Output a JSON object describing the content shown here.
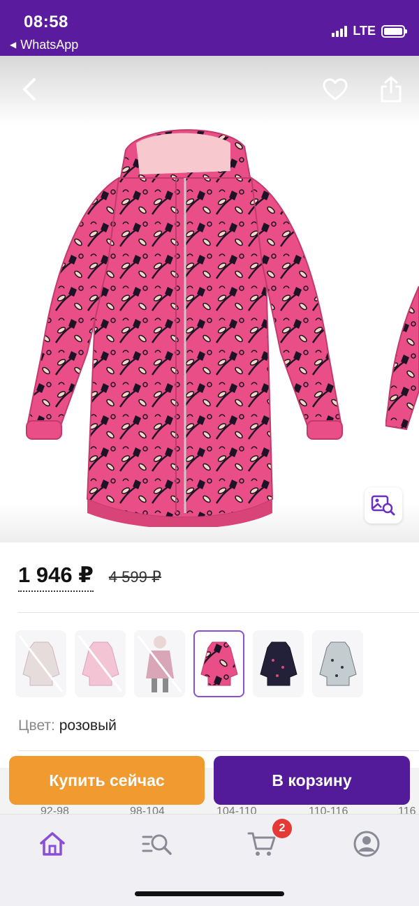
{
  "status_bar": {
    "time": "08:58",
    "back_app": "WhatsApp",
    "network": "LTE",
    "background_color": "#5a1b9e"
  },
  "header": {
    "back_icon": "chevron-left-icon",
    "favorite_icon": "heart-outline-icon",
    "share_icon": "share-icon"
  },
  "product": {
    "price": "1 946 ₽",
    "old_price": "4 599 ₽",
    "color_label": "Цвет:",
    "color_value": "розовый",
    "main_image": "pink floral winter jacket",
    "zoom_icon": "image-search-icon"
  },
  "color_variants": [
    {
      "name": "light-floral",
      "available": false,
      "selected": false
    },
    {
      "name": "pink-pale",
      "available": false,
      "selected": false
    },
    {
      "name": "pink-model",
      "available": false,
      "selected": false
    },
    {
      "name": "pink-floral",
      "available": true,
      "selected": true
    },
    {
      "name": "navy-floral",
      "available": true,
      "selected": false
    },
    {
      "name": "grey-floral",
      "available": true,
      "selected": false
    }
  ],
  "sizes": [
    "92-98",
    "98-104",
    "104-110",
    "110-116",
    "116"
  ],
  "actions": {
    "buy_now": "Купить сейчас",
    "add_to_cart": "В корзину",
    "buy_color": "#f09a2f",
    "cart_color": "#531b9a"
  },
  "tabbar": {
    "items": [
      {
        "icon": "home-icon",
        "active": true
      },
      {
        "icon": "catalog-search-icon",
        "active": false
      },
      {
        "icon": "cart-icon",
        "active": false
      },
      {
        "icon": "profile-icon",
        "active": false
      }
    ],
    "cart_badge": "2",
    "accent_color": "#8a4fd4"
  }
}
